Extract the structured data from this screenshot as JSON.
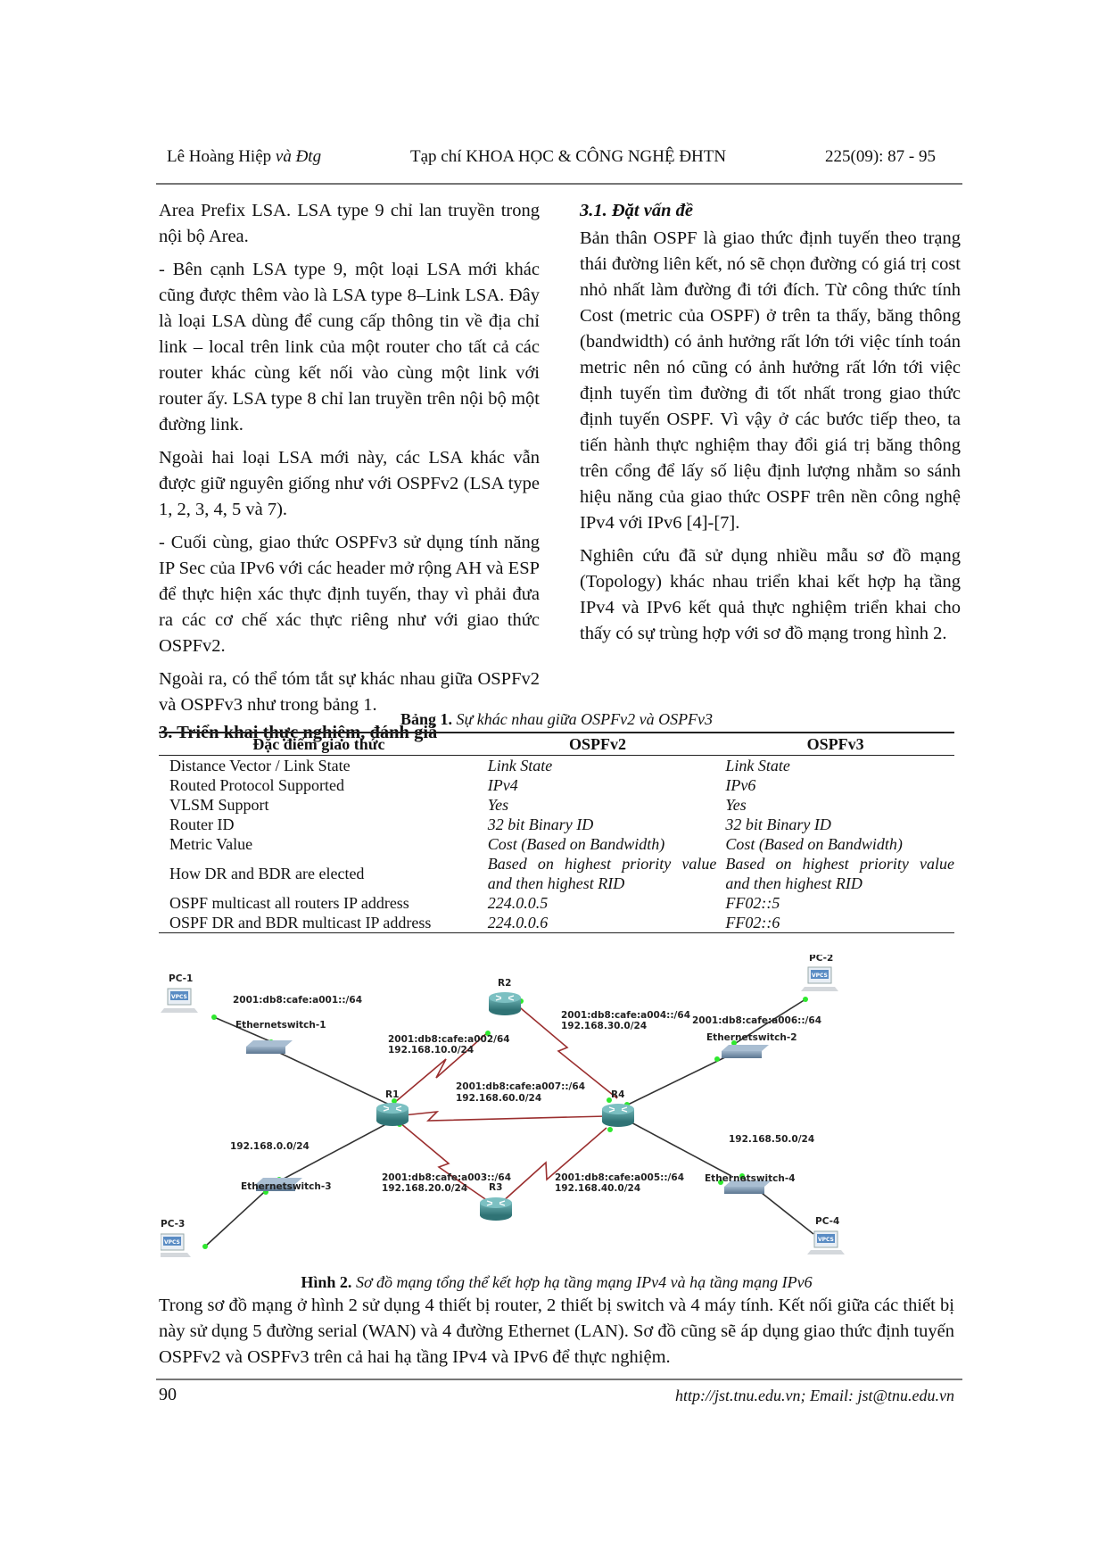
{
  "header": {
    "author": "Lê Hoàng Hiệp",
    "author_suffix": "và Đtg",
    "journal": "Tạp chí KHOA HỌC & CÔNG NGHỆ ĐHTN",
    "volume": "225(09): 87 - 95"
  },
  "left_column": {
    "paragraphs": [
      "Area Prefix LSA. LSA type 9 chỉ lan truyền trong nội bộ Area.",
      "- Bên cạnh LSA type 9, một loại LSA mới khác cũng được thêm vào là LSA type 8–Link LSA. Đây là loại LSA dùng để cung cấp thông tin về địa chỉ link – local trên link của một router cho tất cả các router khác cùng kết nối vào cùng một link với router ấy. LSA type 8 chỉ lan truyền trên nội bộ một đường link.",
      "Ngoài hai loại LSA mới này, các LSA khác vẫn được giữ nguyên giống như với OSPFv2 (LSA type 1, 2, 3, 4, 5 và 7).",
      "- Cuối cùng, giao thức OSPFv3 sử dụng tính năng IP Sec của IPv6 với các header mở rộng AH và ESP để thực hiện xác thực định tuyến, thay vì phải đưa ra các cơ chế xác thực riêng như với giao thức OSPFv2.",
      "Ngoài ra, có thể tóm tắt sự khác nhau giữa OSPFv2 và OSPFv3 như trong bảng 1."
    ],
    "section_heading": "3. Triển khai thực nghiệm, đánh giá"
  },
  "right_column": {
    "subsection_heading": "3.1. Đặt vấn đề",
    "paragraphs": [
      "Bản thân OSPF là giao thức định tuyến theo trạng thái đường liên kết, nó sẽ chọn đường có giá trị cost nhỏ nhất làm đường đi tới đích. Từ công thức tính Cost (metric của OSPF) ở trên ta thấy, băng thông (bandwidth) có ảnh hưởng rất lớn tới việc tính toán metric nên nó cũng có ảnh hưởng rất lớn tới việc định tuyến tìm đường đi tốt nhất trong giao thức định tuyến OSPF. Vì vậy ở các bước tiếp theo, ta tiến hành thực nghiệm thay đổi giá trị băng thông trên cổng để lấy số liệu định lượng nhằm so sánh hiệu năng của giao thức OSPF trên nền công nghệ IPv4 với IPv6 [4]-[7].",
      "Nghiên cứu đã sử dụng nhiều mẫu sơ đồ mạng (Topology) khác nhau triển khai kết hợp hạ tầng IPv4 và IPv6 kết quả thực nghiệm triển khai cho thấy có sự trùng hợp với sơ đồ mạng trong hình 2."
    ]
  },
  "table1": {
    "caption_label": "Bảng 1.",
    "caption_text": "Sự khác nhau giữa OSPFv2 và OSPFv3",
    "headers": [
      "Đặc điểm giao thức",
      "OSPFv2",
      "OSPFv3"
    ],
    "rows": [
      [
        "Distance Vector / Link State",
        "Link State",
        "Link State"
      ],
      [
        "Routed Protocol Supported",
        "IPv4",
        "IPv6"
      ],
      [
        "VLSM Support",
        "Yes",
        "Yes"
      ],
      [
        "Router ID",
        "32 bit Binary ID",
        "32 bit Binary ID"
      ],
      [
        "Metric Value",
        "Cost (Based on Bandwidth)",
        "Cost (Based on Bandwidth)"
      ],
      [
        "How DR and BDR are elected",
        "Based on highest priority value and then highest RID",
        "Based on highest priority value and then highest RID"
      ],
      [
        "OSPF multicast all routers IP address",
        "224.0.0.5",
        "FF02::5"
      ],
      [
        "OSPF DR and BDR multicast IP address",
        "224.0.0.6",
        "FF02::6"
      ]
    ]
  },
  "figure2": {
    "caption_label": "Hình 2.",
    "caption_text": "Sơ đồ mạng tổng thể kết hợp hạ tầng mạng IPv4 và hạ tầng mạng IPv6",
    "colors": {
      "serial_link": "#9b2f2f",
      "ethernet_link": "#333333",
      "router": "#3d8a8c",
      "switch": "#6f89a3",
      "port": "#2ee82e"
    },
    "devices": {
      "pc1": "PC-1",
      "pc2": "PC-2",
      "pc3": "PC-3",
      "pc4": "PC-4",
      "pc_badge": "VPCS",
      "r1": "R1",
      "r2": "R2",
      "r3": "R3",
      "r4": "R4",
      "sw1": "Ethernetswitch-1",
      "sw2": "Ethernetswitch-2",
      "sw3": "Ethernetswitch-3",
      "sw4": "Ethernetswitch-4"
    },
    "labels": {
      "lan1": "2001:db8:cafe:a001::/64",
      "r1r2_v6": "2001:db8:cafe:a002/64",
      "r1r2_v4": "192.168.10.0/24",
      "r2r4_v6": "2001:db8:cafe:a004::/64",
      "r2r4_v4": "192.168.30.0/24",
      "lan2": "2001:db8:cafe:a006::/64",
      "r1r4_v6": "2001:db8:cafe:a007::/64",
      "r1r4_v4": "192.168.60.0/24",
      "lan3": "192.168.0.0/24",
      "lan4": "192.168.50.0/24",
      "r1r3_v6": "2001:db8:cafe:a003::/64",
      "r1r3_v4": "192.168.20.0/24",
      "r3r4_v6": "2001:db8:cafe:a005::/64",
      "r3r4_v4": "192.168.40.0/24"
    }
  },
  "body_paragraph": "Trong sơ đồ mạng ở hình 2 sử dụng 4 thiết bị router, 2 thiết bị switch và 4 máy tính. Kết nối giữa các thiết bị này sử dụng 5 đường serial (WAN) và 4 đường Ethernet (LAN). Sơ đồ cũng sẽ áp dụng giao thức định tuyến OSPFv2 và OSPFv3 trên cả hai hạ tầng IPv4 và IPv6 để thực nghiệm.",
  "footer": {
    "page_number": "90",
    "contact": "http://jst.tnu.edu.vn;  Email: jst@tnu.edu.vn"
  }
}
